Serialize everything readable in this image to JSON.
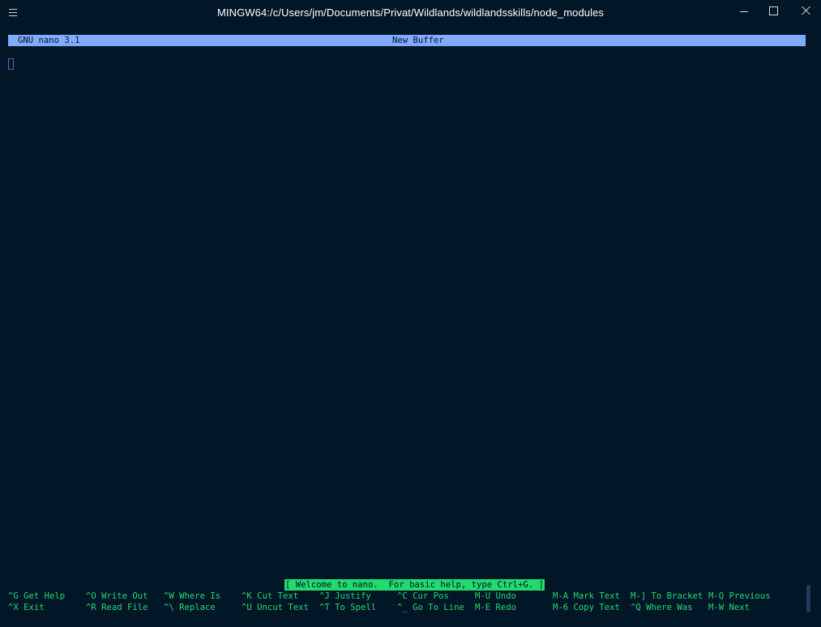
{
  "window": {
    "title": "MINGW64:/c/Users/jm/Documents/Privat/Wildlands/wildlandsskills/node_modules",
    "icons": {
      "menu": "hamburger-menu-icon",
      "minimize": "minimize-icon",
      "maximize": "maximize-icon",
      "close": "close-icon"
    }
  },
  "nano": {
    "version": "GNU nano 3.1",
    "filename": "New Buffer",
    "status": "[ Welcome to nano.  For basic help, type Ctrl+G. ]",
    "shortcuts": {
      "row1": [
        {
          "key": "^G",
          "label": "Get Help"
        },
        {
          "key": "^O",
          "label": "Write Out"
        },
        {
          "key": "^W",
          "label": "Where Is"
        },
        {
          "key": "^K",
          "label": "Cut Text"
        },
        {
          "key": "^J",
          "label": "Justify"
        },
        {
          "key": "^C",
          "label": "Cur Pos"
        },
        {
          "key": "M-U",
          "label": "Undo"
        },
        {
          "key": "M-A",
          "label": "Mark Text"
        },
        {
          "key": "M-]",
          "label": "To Bracket"
        },
        {
          "key": "M-Q",
          "label": "Previous"
        }
      ],
      "row2": [
        {
          "key": "^X",
          "label": "Exit"
        },
        {
          "key": "^R",
          "label": "Read File"
        },
        {
          "key": "^\\",
          "label": "Replace"
        },
        {
          "key": "^U",
          "label": "Uncut Text"
        },
        {
          "key": "^T",
          "label": "To Spell"
        },
        {
          "key": "^_",
          "label": "Go To Line"
        },
        {
          "key": "M-E",
          "label": "Redo"
        },
        {
          "key": "M-6",
          "label": "Copy Text"
        },
        {
          "key": "^Q",
          "label": "Where Was"
        },
        {
          "key": "M-W",
          "label": "Next"
        }
      ]
    }
  },
  "colors": {
    "background": "#011627",
    "header": "#82aaff",
    "shortcut_text": "#22da6e",
    "cursor": "#7e57c2"
  }
}
